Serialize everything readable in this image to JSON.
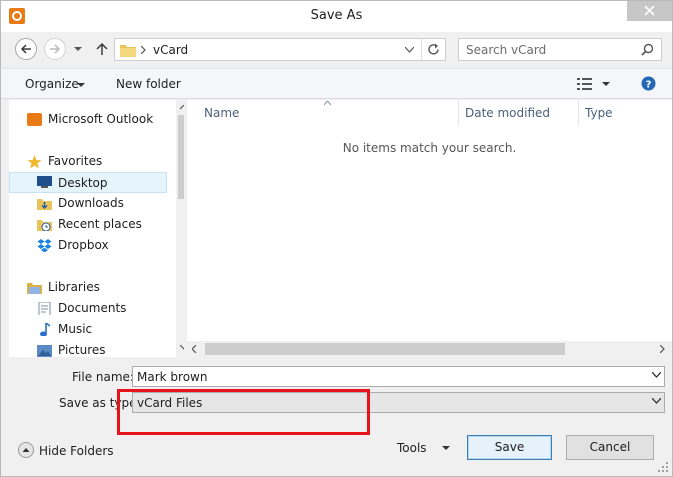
{
  "window": {
    "title": "Save As"
  },
  "address": {
    "path": "vCard",
    "search_placeholder": "Search vCard"
  },
  "toolbar": {
    "organize": "Organize",
    "new_folder": "New folder"
  },
  "nav": {
    "items": [
      {
        "label": "Microsoft Outlook",
        "icon": "outlook-icon"
      },
      {
        "label": "Favorites",
        "icon": "star-icon"
      },
      {
        "label": "Desktop",
        "icon": "desktop-icon"
      },
      {
        "label": "Downloads",
        "icon": "downloads-folder-icon"
      },
      {
        "label": "Recent places",
        "icon": "recent-places-icon"
      },
      {
        "label": "Dropbox",
        "icon": "dropbox-icon"
      },
      {
        "label": "Libraries",
        "icon": "libraries-icon"
      },
      {
        "label": "Documents",
        "icon": "documents-icon"
      },
      {
        "label": "Music",
        "icon": "music-icon"
      },
      {
        "label": "Pictures",
        "icon": "pictures-icon"
      }
    ],
    "selected": "Desktop"
  },
  "filelist": {
    "columns": [
      "Name",
      "Date modified",
      "Type"
    ],
    "empty_message": "No items match your search."
  },
  "form": {
    "filename_label": "File name:",
    "filename_value": "Mark brown",
    "savetype_label": "Save as type:",
    "savetype_value": "vCard Files"
  },
  "footer": {
    "hide_folders": "Hide Folders",
    "tools": "Tools",
    "save": "Save",
    "cancel": "Cancel"
  },
  "colors": {
    "highlight": "#e8141b",
    "accent": "#3c7fb1"
  }
}
